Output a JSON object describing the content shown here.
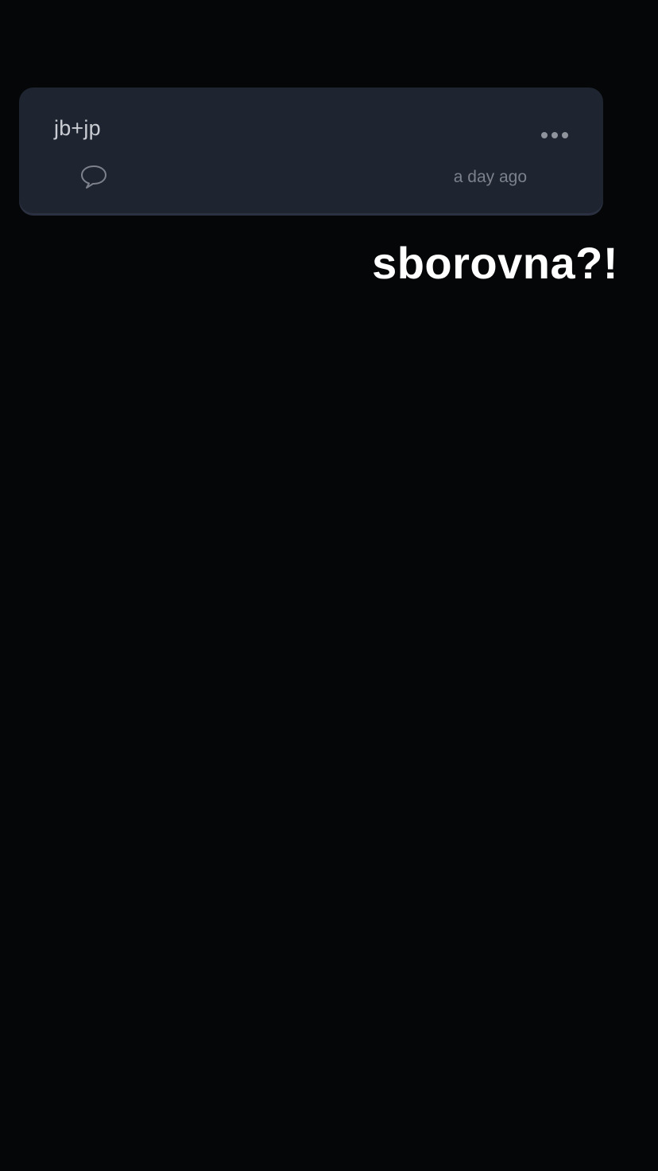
{
  "post": {
    "title": "jb+jp",
    "timestamp": "a day ago",
    "comment_icon": "speech-bubble-icon",
    "menu_icon": "more-horizontal-icon"
  },
  "overlay": {
    "caption": "sborovna?!"
  },
  "colors": {
    "background": "#050608",
    "card": "#1e2430",
    "title_text": "#c9ccd2",
    "muted_text": "#7c818b",
    "caption": "#ffffff"
  }
}
